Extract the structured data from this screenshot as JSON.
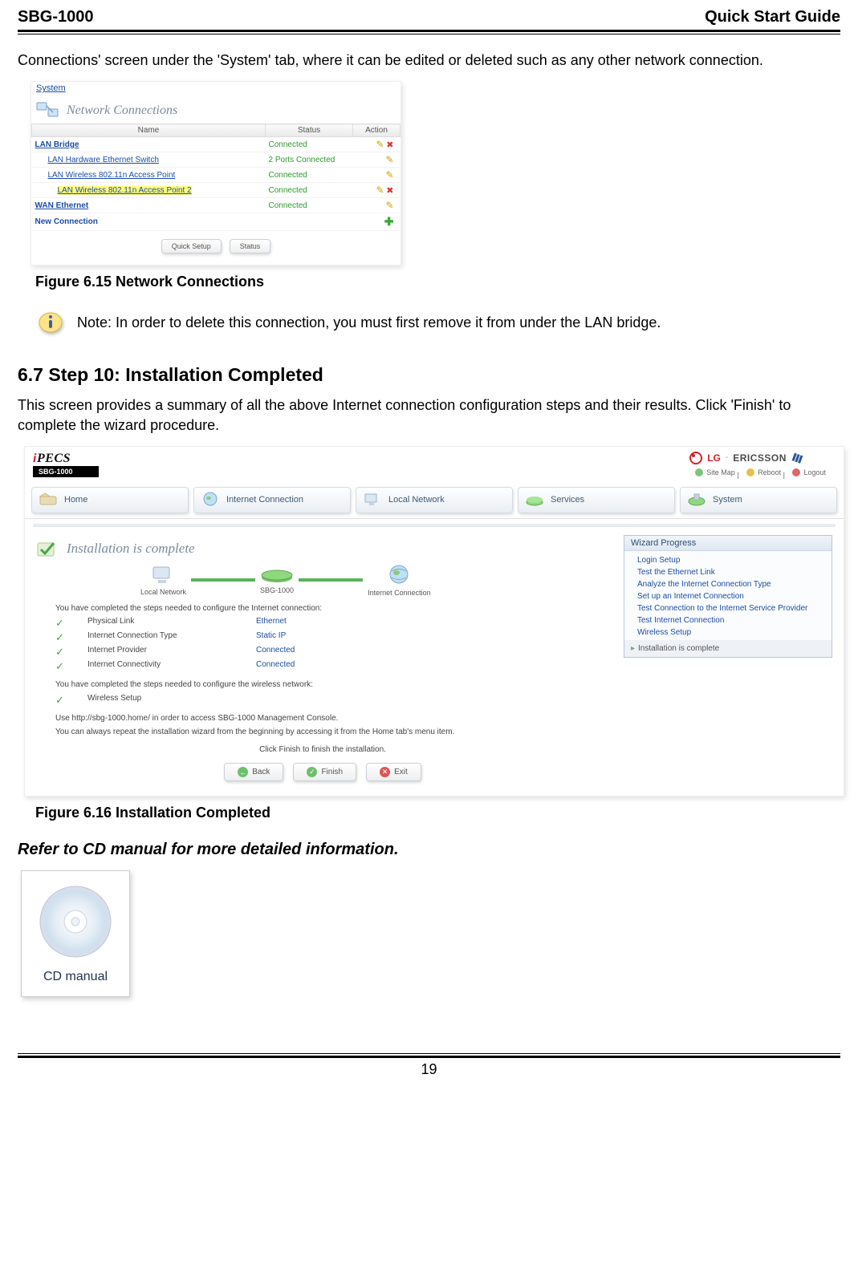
{
  "header": {
    "left": "SBG-1000",
    "right": "Quick Start Guide"
  },
  "intro_p": "Connections' screen under the 'System' tab, where it can be edited or deleted such as any other network connection.",
  "shot1": {
    "syslink": "System",
    "title": "Network Connections",
    "cols": [
      "Name",
      "Status",
      "Action"
    ],
    "rows": [
      {
        "name": "LAN Bridge",
        "status": "Connected",
        "indent": 0,
        "bold": true,
        "hl": false,
        "act": "px"
      },
      {
        "name": "LAN Hardware Ethernet Switch",
        "status": "2 Ports Connected",
        "indent": 1,
        "bold": false,
        "hl": false,
        "act": "p"
      },
      {
        "name": "LAN Wireless 802.11n Access Point",
        "status": "Connected",
        "indent": 1,
        "bold": false,
        "hl": false,
        "act": "p"
      },
      {
        "name": "LAN Wireless 802.11n Access Point 2",
        "status": "Connected",
        "indent": 2,
        "bold": false,
        "hl": true,
        "act": "px"
      },
      {
        "name": "WAN Ethernet",
        "status": "Connected",
        "indent": 0,
        "bold": true,
        "hl": false,
        "act": "p"
      }
    ],
    "new_row": "New Connection",
    "buttons": [
      "Quick Setup",
      "Status"
    ]
  },
  "fig1": "Figure 6.15 Network Connections",
  "note": "Note: In order to delete this connection, you must first remove it from under the LAN bridge.",
  "section": "6.7 Step 10: Installation Completed",
  "section_p": "This screen provides a summary of all the above Internet connection configuration steps and their results. Click 'Finish' to complete the wizard procedure.",
  "shot2": {
    "sbg": "SBG-1000",
    "brand1": "LG",
    "brand2": "ERICSSON",
    "toplinks": {
      "sitemap": "Site Map",
      "reboot": "Reboot",
      "logout": "Logout"
    },
    "tabs": [
      "Home",
      "Internet Connection",
      "Local Network",
      "Services",
      "System"
    ],
    "inst_title": "Installation is complete",
    "topo": {
      "a": "Local Network",
      "b": "SBG-1000",
      "c": "Internet Connection"
    },
    "p1": "You have completed the steps needed to configure the Internet connection:",
    "checklist": [
      {
        "label": "Physical Link",
        "value": "Ethernet"
      },
      {
        "label": "Internet Connection Type",
        "value": "Static IP"
      },
      {
        "label": "Internet Provider",
        "value": "Connected"
      },
      {
        "label": "Internet Connectivity",
        "value": "Connected"
      }
    ],
    "p2": "You have completed the steps needed to configure the wireless network:",
    "checklist2": [
      {
        "label": "Wireless Setup",
        "value": ""
      }
    ],
    "p3a": "Use http://sbg-1000.home/ in order to access SBG-1000 Management Console.",
    "p3b": "You can always repeat the installation wizard from the beginning by accessing it from the Home tab's menu item.",
    "finish_line": "Click Finish to finish the installation.",
    "buttons": {
      "back": "Back",
      "finish": "Finish",
      "exit": "Exit"
    },
    "wizard_title": "Wizard Progress",
    "wizard_steps": [
      "Login Setup",
      "Test the Ethernet Link",
      "Analyze the Internet Connection Type",
      "Set up an Internet Connection",
      "Test Connection to the Internet Service Provider",
      "Test Internet Connection",
      "Wireless Setup"
    ],
    "wizard_current": "Installation is complete"
  },
  "fig2": "Figure 6.16 Installation Completed",
  "cd_ref": "Refer to CD manual for more detailed information.",
  "cd_label": "CD manual",
  "page": "19"
}
